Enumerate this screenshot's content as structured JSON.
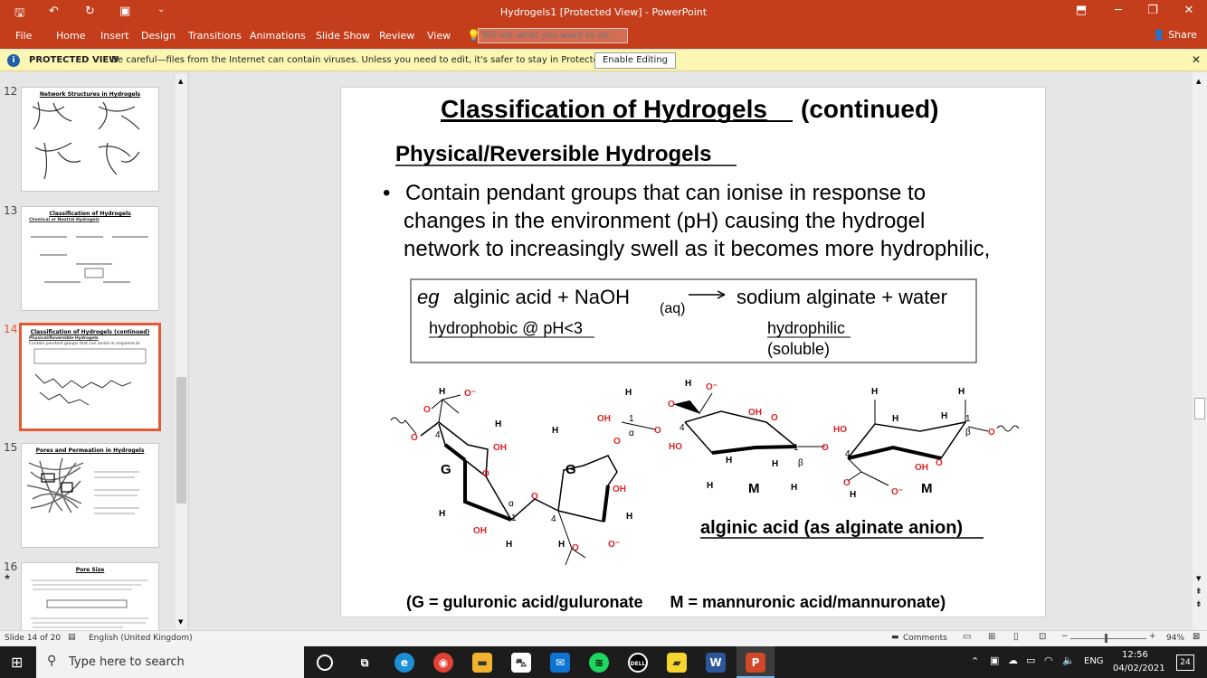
{
  "window": {
    "title": "Hydrogels1 [Protected View] - PowerPoint"
  },
  "ribbon": {
    "tabs": [
      "File",
      "Home",
      "Insert",
      "Design",
      "Transitions",
      "Animations",
      "Slide Show",
      "Review",
      "View"
    ],
    "tellme_placeholder": "Tell me what you want to do...",
    "share": "Share"
  },
  "protected": {
    "title": "PROTECTED VIEW",
    "message": "Be careful—files from the Internet can contain viruses. Unless you need to edit, it's safer to stay in Protected View.",
    "button": "Enable Editing"
  },
  "thumbnails": [
    {
      "num": "12",
      "title": "Network Structures in Hydrogels",
      "selected": false
    },
    {
      "num": "13",
      "title": "Classification of Hydrogels",
      "sub": "Chemical or Neutral Hydrogels",
      "selected": false
    },
    {
      "num": "14",
      "title": "Classification of Hydrogels (continued)",
      "sub": "Physical/Reversible Hydrogels",
      "selected": true
    },
    {
      "num": "15",
      "title": "Pores and Permeation in Hydrogels",
      "selected": false
    },
    {
      "num": "16",
      "title": "Pore Size",
      "selected": false
    }
  ],
  "slide": {
    "title_u": "Classification of Hydrogels",
    "title_rest": " (continued)",
    "subtitle": "Physical/Reversible Hydrogels",
    "bullet_lines": [
      "Contain pendant groups that can ionise in response to",
      "changes in the environment (pH) causing the hydrogel",
      "network to increasingly swell as it becomes more hydrophilic,"
    ],
    "eq": {
      "eg": "eg",
      "left": "alginic acid  +  NaOH",
      "sub": "(aq)",
      "right": "sodium alginate + water",
      "hydrophobic": "hydrophobic @ pH<3",
      "hydrophilic": "hydrophilic",
      "soluble": "(soluble)"
    },
    "alginic_label": "alginic acid (as alginate anion)",
    "footer": "(G = guluronic acid/guluronate      M = mannuronic acid/mannuronate)"
  },
  "status": {
    "slide": "Slide 14 of 20",
    "language": "English (United Kingdom)",
    "comments": "Comments",
    "zoom": "94%"
  },
  "taskbar": {
    "search_placeholder": "Type here to search",
    "lang": "ENG",
    "time": "12:56",
    "date": "04/02/2021",
    "notif": "24"
  }
}
